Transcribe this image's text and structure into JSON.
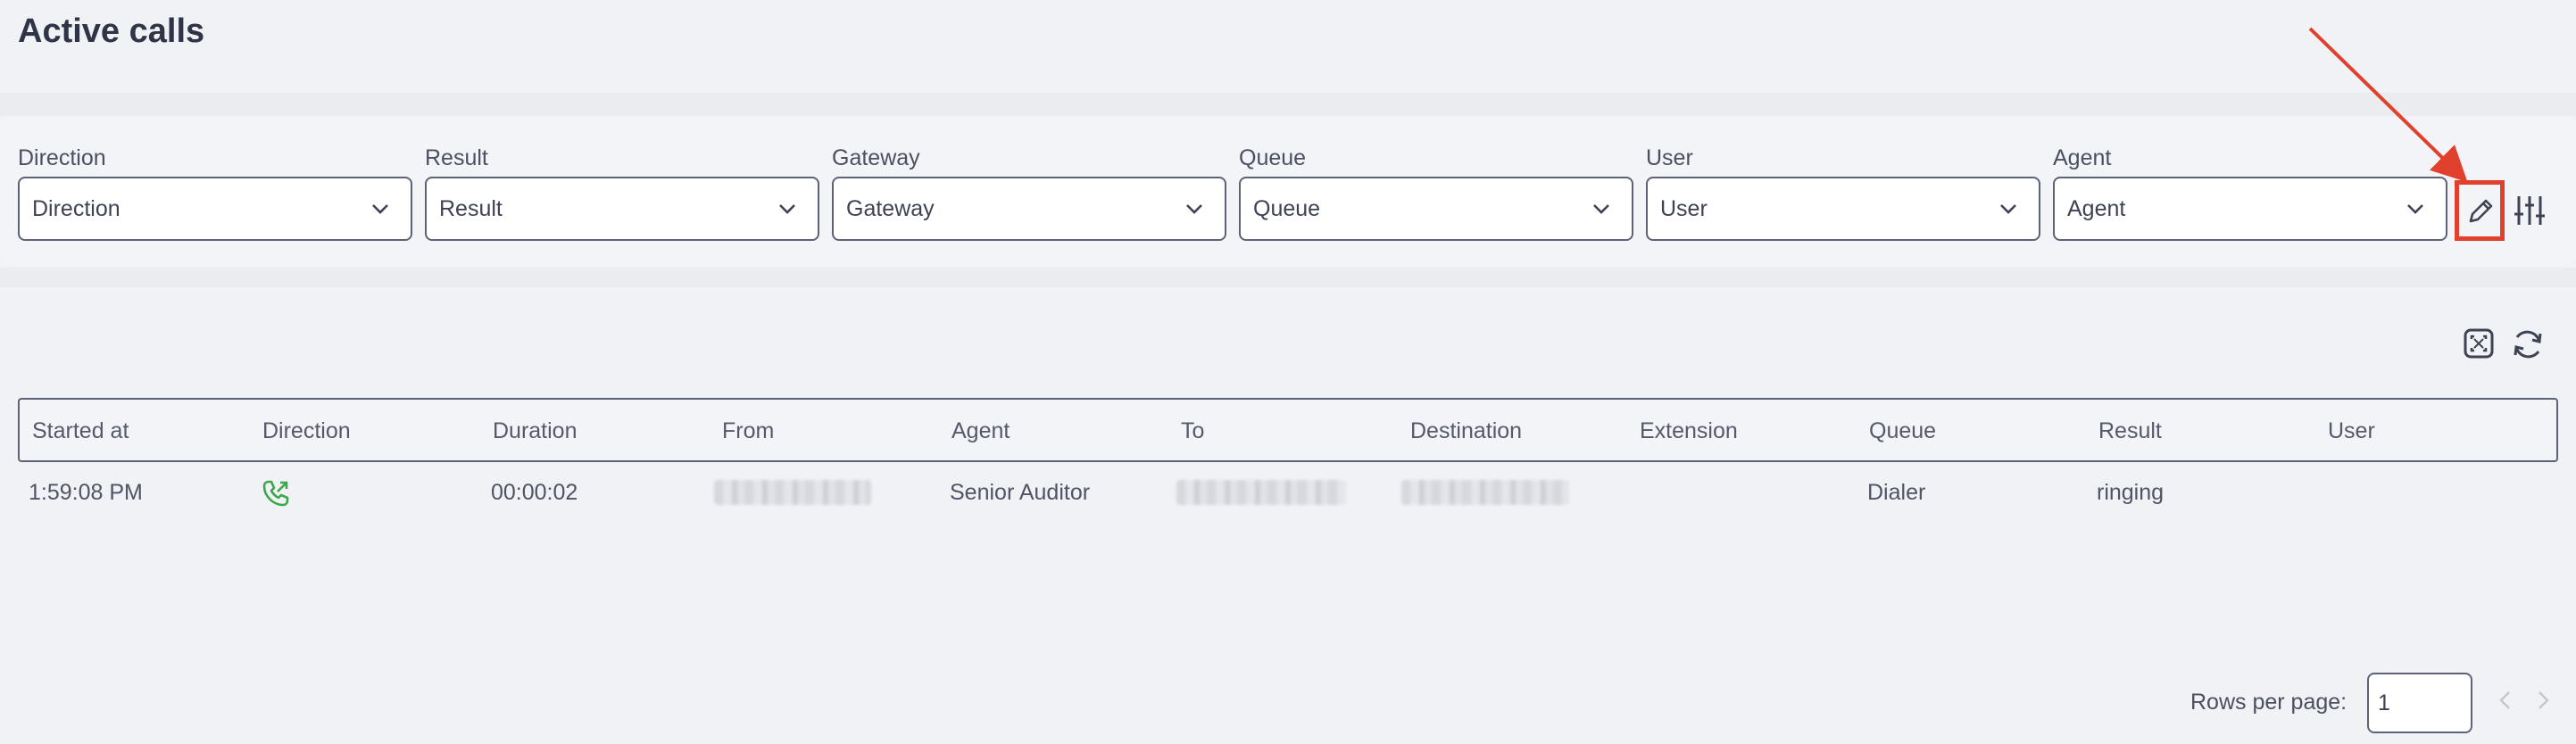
{
  "page": {
    "title": "Active calls"
  },
  "filters": [
    {
      "label": "Direction",
      "placeholder": "Direction"
    },
    {
      "label": "Result",
      "placeholder": "Result"
    },
    {
      "label": "Gateway",
      "placeholder": "Gateway"
    },
    {
      "label": "Queue",
      "placeholder": "Queue"
    },
    {
      "label": "User",
      "placeholder": "User"
    },
    {
      "label": "Agent",
      "placeholder": "Agent"
    }
  ],
  "toolbar": {
    "edit_icon": "pencil-icon",
    "settings_icon": "sliders-icon",
    "expand_icon": "expand-icon",
    "refresh_icon": "refresh-icon"
  },
  "table": {
    "columns": [
      "Started at",
      "Direction",
      "Duration",
      "From",
      "Agent",
      "To",
      "Destination",
      "Extension",
      "Queue",
      "Result",
      "User"
    ],
    "rows": [
      {
        "started_at": "1:59:08 PM",
        "direction_icon": "outgoing-call-icon",
        "duration": "00:00:02",
        "from": "",
        "agent": "Senior Auditor",
        "to": "",
        "destination": "",
        "extension": "",
        "queue": "Dialer",
        "result": "ringing",
        "user": ""
      }
    ]
  },
  "pagination": {
    "rows_per_page_label": "Rows per page:",
    "rows_per_page_value": "1"
  },
  "colors": {
    "annotation": "#e0402c",
    "call_icon": "#3aa84a",
    "border": "#5d6275"
  }
}
